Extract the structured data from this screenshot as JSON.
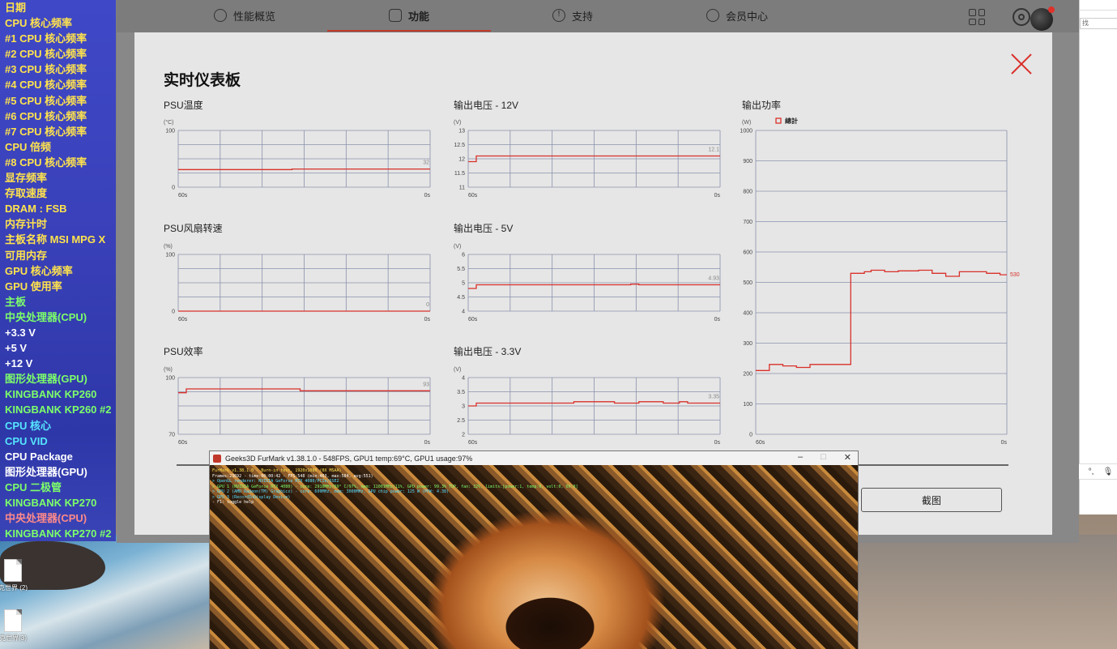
{
  "osd": {
    "items": [
      {
        "label": "日期",
        "color": "#ffe34d"
      },
      {
        "label": "CPU 核心频率",
        "color": "#ffe34d"
      },
      {
        "label": "#1 CPU 核心频率",
        "color": "#ffe34d"
      },
      {
        "label": "#2 CPU 核心频率",
        "color": "#ffe34d"
      },
      {
        "label": "#3 CPU 核心频率",
        "color": "#ffe34d"
      },
      {
        "label": "#4 CPU 核心频率",
        "color": "#ffe34d"
      },
      {
        "label": "#5 CPU 核心频率",
        "color": "#ffe34d"
      },
      {
        "label": "#6 CPU 核心频率",
        "color": "#ffe34d"
      },
      {
        "label": "#7 CPU 核心频率",
        "color": "#ffe34d"
      },
      {
        "label": "CPU 倍频",
        "color": "#ffe34d"
      },
      {
        "label": "#8 CPU 核心频率",
        "color": "#ffe34d"
      },
      {
        "label": "显存频率",
        "color": "#ffe34d"
      },
      {
        "label": "存取速度",
        "color": "#ffe34d"
      },
      {
        "label": "DRAM : FSB",
        "color": "#ffe34d"
      },
      {
        "label": "内存计时",
        "color": "#ffe34d"
      },
      {
        "label": "主板名称   MSI MPG X",
        "color": "#ffe34d"
      },
      {
        "label": "可用内存",
        "color": "#ffe34d"
      },
      {
        "label": "GPU 核心频率",
        "color": "#ffe34d"
      },
      {
        "label": "GPU 使用率",
        "color": "#ffe34d"
      },
      {
        "label": "主板",
        "color": "#7dff6a"
      },
      {
        "label": "中央处理器(CPU)",
        "color": "#7dff6a"
      },
      {
        "label": "+3.3 V",
        "color": "#ffffff"
      },
      {
        "label": "+5 V",
        "color": "#ffffff"
      },
      {
        "label": "+12 V",
        "color": "#ffffff"
      },
      {
        "label": "图形处理器(GPU)",
        "color": "#7dff6a"
      },
      {
        "label": "KINGBANK KP260",
        "color": "#7dff6a"
      },
      {
        "label": "KINGBANK KP260 #2",
        "color": "#7dff6a"
      },
      {
        "label": "CPU 核心",
        "color": "#55e6ff"
      },
      {
        "label": "CPU VID",
        "color": "#55e6ff"
      },
      {
        "label": "CPU Package",
        "color": "#ffffff"
      },
      {
        "label": "图形处理器(GPU)",
        "color": "#ffffff"
      },
      {
        "label": "CPU 二极管",
        "color": "#7dff6a"
      },
      {
        "label": "KINGBANK KP270",
        "color": "#7dff6a"
      },
      {
        "label": "中央处理器(CPU)",
        "color": "#ff8a8a"
      },
      {
        "label": "KINGBANK KP270 #2",
        "color": "#7dff6a"
      }
    ]
  },
  "nav": {
    "tabs": [
      {
        "label": "性能概览",
        "icon": "gauge-icon"
      },
      {
        "label": "功能",
        "icon": "function-icon"
      },
      {
        "label": "支持",
        "icon": "alert-icon"
      },
      {
        "label": "会员中心",
        "icon": "user-icon"
      }
    ],
    "active_tab": "功能",
    "accent": "#c0392b"
  },
  "panel": {
    "title": "实时仪表板",
    "screenshot_button": "截图"
  },
  "charts": [
    {
      "id": "psu-temp",
      "title": "PSU温度",
      "unit": "(°C)",
      "y_ticks": [
        "100",
        "0"
      ],
      "ylim": [
        0,
        100
      ],
      "x_labels": [
        "60s",
        "0s"
      ],
      "value_label": "32",
      "series": [
        31,
        31,
        31,
        31,
        31,
        31,
        31,
        31,
        31,
        31,
        31,
        31,
        31,
        31,
        32,
        32,
        32,
        32,
        32,
        32,
        32,
        32,
        32,
        32,
        32,
        32,
        32,
        32,
        32,
        32,
        32
      ]
    },
    {
      "id": "out-12v",
      "title": "输出电压 - 12V",
      "unit": "(V)",
      "y_ticks": [
        "13",
        "12.5",
        "12",
        "11.5",
        "11"
      ],
      "ylim": [
        11,
        13
      ],
      "x_labels": [
        "60s",
        "0s"
      ],
      "value_label": "12.1",
      "series": [
        11.9,
        12.1,
        12.1,
        12.1,
        12.1,
        12.1,
        12.1,
        12.1,
        12.1,
        12.1,
        12.1,
        12.1,
        12.1,
        12.1,
        12.1,
        12.1,
        12.1,
        12.1,
        12.1,
        12.1,
        12.1,
        12.1,
        12.1,
        12.1,
        12.1,
        12.1,
        12.1,
        12.1,
        12.1,
        12.1,
        12.1
      ]
    },
    {
      "id": "psu-fan",
      "title": "PSU风扇转速",
      "unit": "(%)",
      "y_ticks": [
        "100",
        "0"
      ],
      "ylim": [
        0,
        100
      ],
      "x_labels": [
        "60s",
        "0s"
      ],
      "value_label": "0",
      "series": [
        0,
        0,
        0,
        0,
        0,
        0,
        0,
        0,
        0,
        0,
        0,
        0,
        0,
        0,
        0,
        0,
        0,
        0,
        0,
        0,
        0,
        0,
        0,
        0,
        0,
        0,
        0,
        0,
        0,
        0,
        0
      ]
    },
    {
      "id": "out-5v",
      "title": "输出电压 - 5V",
      "unit": "(V)",
      "y_ticks": [
        "6",
        "5.5",
        "5",
        "4.5",
        "4"
      ],
      "ylim": [
        4,
        6
      ],
      "x_labels": [
        "60s",
        "0s"
      ],
      "value_label": "4.93",
      "series": [
        4.8,
        4.93,
        4.93,
        4.93,
        4.93,
        4.93,
        4.93,
        4.93,
        4.93,
        4.93,
        4.93,
        4.93,
        4.93,
        4.93,
        4.93,
        4.93,
        4.93,
        4.93,
        4.93,
        4.93,
        4.95,
        4.93,
        4.93,
        4.93,
        4.93,
        4.93,
        4.93,
        4.93,
        4.93,
        4.93,
        4.93
      ]
    },
    {
      "id": "psu-eff",
      "title": "PSU效率",
      "unit": "(%)",
      "y_ticks": [
        "100",
        "70"
      ],
      "ylim": [
        70,
        100
      ],
      "x_labels": [
        "60s",
        "0s"
      ],
      "value_label": "93",
      "series": [
        92,
        94,
        94,
        94,
        94,
        94,
        94,
        94,
        94,
        94,
        94,
        94,
        94,
        94,
        94,
        93,
        93,
        93,
        93,
        93,
        93,
        93,
        93,
        93,
        93,
        93,
        93,
        93,
        93,
        93,
        93
      ]
    },
    {
      "id": "out-33v",
      "title": "输出电压 - 3.3V",
      "unit": "(V)",
      "y_ticks": [
        "4",
        "3.5",
        "3",
        "2.5",
        "2"
      ],
      "ylim": [
        2,
        4
      ],
      "x_labels": [
        "60s",
        "0s"
      ],
      "value_label": "3.35",
      "series": [
        3.0,
        3.1,
        3.1,
        3.1,
        3.1,
        3.1,
        3.1,
        3.1,
        3.1,
        3.1,
        3.1,
        3.1,
        3.1,
        3.15,
        3.15,
        3.15,
        3.15,
        3.15,
        3.1,
        3.1,
        3.1,
        3.15,
        3.15,
        3.15,
        3.1,
        3.1,
        3.15,
        3.1,
        3.1,
        3.1,
        3.1
      ]
    },
    {
      "id": "out-power",
      "title": "输出功率",
      "unit": "(W)",
      "legend": "總計",
      "y_ticks": [
        "1000",
        "900",
        "800",
        "700",
        "600",
        "500",
        "400",
        "300",
        "200",
        "100",
        "0"
      ],
      "ylim": [
        0,
        1000
      ],
      "x_labels": [
        "60s",
        "0s"
      ],
      "value_label": "530",
      "series": [
        210,
        210,
        230,
        230,
        225,
        225,
        220,
        220,
        230,
        230,
        230,
        230,
        230,
        230,
        530,
        530,
        535,
        540,
        540,
        535,
        535,
        538,
        538,
        538,
        540,
        540,
        530,
        530,
        520,
        520,
        535,
        535,
        535,
        535,
        530,
        530,
        525
      ]
    }
  ],
  "chart_data": [
    {
      "type": "line",
      "title": "PSU温度",
      "ylabel": "(°C)",
      "ylim": [
        0,
        100
      ],
      "x": [
        "60s",
        "0s"
      ],
      "series": [
        {
          "values": [
            31,
            31,
            31,
            31,
            31,
            31,
            31,
            31,
            31,
            31,
            31,
            31,
            31,
            31,
            32,
            32,
            32,
            32,
            32,
            32,
            32,
            32,
            32,
            32,
            32,
            32,
            32,
            32,
            32,
            32,
            32
          ]
        }
      ]
    },
    {
      "type": "line",
      "title": "输出电压 - 12V",
      "ylabel": "(V)",
      "ylim": [
        11,
        13
      ],
      "x": [
        "60s",
        "0s"
      ],
      "series": [
        {
          "values": [
            11.9,
            12.1,
            12.1,
            12.1,
            12.1,
            12.1,
            12.1,
            12.1,
            12.1,
            12.1,
            12.1,
            12.1,
            12.1,
            12.1,
            12.1,
            12.1,
            12.1,
            12.1,
            12.1,
            12.1,
            12.1,
            12.1,
            12.1,
            12.1,
            12.1,
            12.1,
            12.1,
            12.1,
            12.1,
            12.1,
            12.1
          ]
        }
      ]
    },
    {
      "type": "line",
      "title": "PSU风扇转速",
      "ylabel": "(%)",
      "ylim": [
        0,
        100
      ],
      "x": [
        "60s",
        "0s"
      ],
      "series": [
        {
          "values": [
            0,
            0,
            0,
            0,
            0,
            0,
            0,
            0,
            0,
            0,
            0,
            0,
            0,
            0,
            0,
            0,
            0,
            0,
            0,
            0,
            0,
            0,
            0,
            0,
            0,
            0,
            0,
            0,
            0,
            0,
            0
          ]
        }
      ]
    },
    {
      "type": "line",
      "title": "输出电压 - 5V",
      "ylabel": "(V)",
      "ylim": [
        4,
        6
      ],
      "x": [
        "60s",
        "0s"
      ],
      "series": [
        {
          "values": [
            4.8,
            4.93,
            4.93,
            4.93,
            4.93,
            4.93,
            4.93,
            4.93,
            4.93,
            4.93,
            4.93,
            4.93,
            4.93,
            4.93,
            4.93,
            4.93,
            4.93,
            4.93,
            4.93,
            4.93,
            4.95,
            4.93,
            4.93,
            4.93,
            4.93,
            4.93,
            4.93,
            4.93,
            4.93,
            4.93,
            4.93
          ]
        }
      ]
    },
    {
      "type": "line",
      "title": "PSU效率",
      "ylabel": "(%)",
      "ylim": [
        70,
        100
      ],
      "x": [
        "60s",
        "0s"
      ],
      "series": [
        {
          "values": [
            92,
            94,
            94,
            94,
            94,
            94,
            94,
            94,
            94,
            94,
            94,
            94,
            94,
            94,
            94,
            93,
            93,
            93,
            93,
            93,
            93,
            93,
            93,
            93,
            93,
            93,
            93,
            93,
            93,
            93,
            93
          ]
        }
      ]
    },
    {
      "type": "line",
      "title": "输出电压 - 3.3V",
      "ylabel": "(V)",
      "ylim": [
        2,
        4
      ],
      "x": [
        "60s",
        "0s"
      ],
      "series": [
        {
          "values": [
            3.0,
            3.1,
            3.1,
            3.1,
            3.1,
            3.1,
            3.1,
            3.1,
            3.1,
            3.1,
            3.1,
            3.1,
            3.1,
            3.15,
            3.15,
            3.15,
            3.15,
            3.15,
            3.1,
            3.1,
            3.1,
            3.15,
            3.15,
            3.15,
            3.1,
            3.1,
            3.15,
            3.1,
            3.1,
            3.1,
            3.1
          ]
        }
      ]
    },
    {
      "type": "line",
      "title": "输出功率",
      "ylabel": "(W)",
      "ylim": [
        0,
        1000
      ],
      "x": [
        "60s",
        "0s"
      ],
      "series": [
        {
          "name": "總計",
          "values": [
            210,
            210,
            230,
            230,
            225,
            225,
            220,
            220,
            230,
            230,
            230,
            230,
            230,
            230,
            530,
            530,
            535,
            540,
            540,
            535,
            535,
            538,
            538,
            538,
            540,
            540,
            530,
            530,
            520,
            520,
            535,
            535,
            535,
            535,
            530,
            530,
            525
          ]
        }
      ]
    }
  ],
  "furmark": {
    "title": "Geeks3D FurMark v1.38.1.0 - 548FPS, GPU1 temp:69°C, GPU1 usage:97%",
    "overlay_lines": [
      {
        "text": "FurMark v1.38.1.0 - Burn-in test, 1920x1080 (0X MSAA)",
        "color": "#ffe34d"
      },
      {
        "text": "Frames:23692 - time:00:00:42 - FPS:548 (min:463, max:584, avg:551)",
        "color": "#ffffff"
      },
      {
        "text": "> OpenGL renderer: NVIDIA GeForce RTX 4080/PCIe/SSE2",
        "color": "#55ddff"
      },
      {
        "text": "> GPU 1 (NVIDIA GeForce RTX 4080) - core: 2910MHz/69° C/97%, mem: 11001MHz/11%, GPU power: 99.3% TDP, fan: 32%, limits:[power:1, temp:0, volt:0, OV:0]",
        "color": "#7dff6a"
      },
      {
        "text": "> GPU 2 (AMD Radeon(TM) Graphics) - core: 600MHz, mem: 3000MHz, GPU chip power: 125 W (PPW: 4.38)",
        "color": "#55ddff"
      },
      {
        "text": "> GPU 3 (RecordInDisplay Device)",
        "color": "#55ddff"
      },
      {
        "text": "- F1: toggle help",
        "color": "#ffffff"
      }
    ]
  },
  "desktop": {
    "icons": [
      {
        "label": "克世界 (2)"
      },
      {
        "label": "克世界(3)"
      }
    ]
  },
  "right_window": {
    "search_placeholder": "找"
  },
  "ime": {
    "lang": "中"
  }
}
